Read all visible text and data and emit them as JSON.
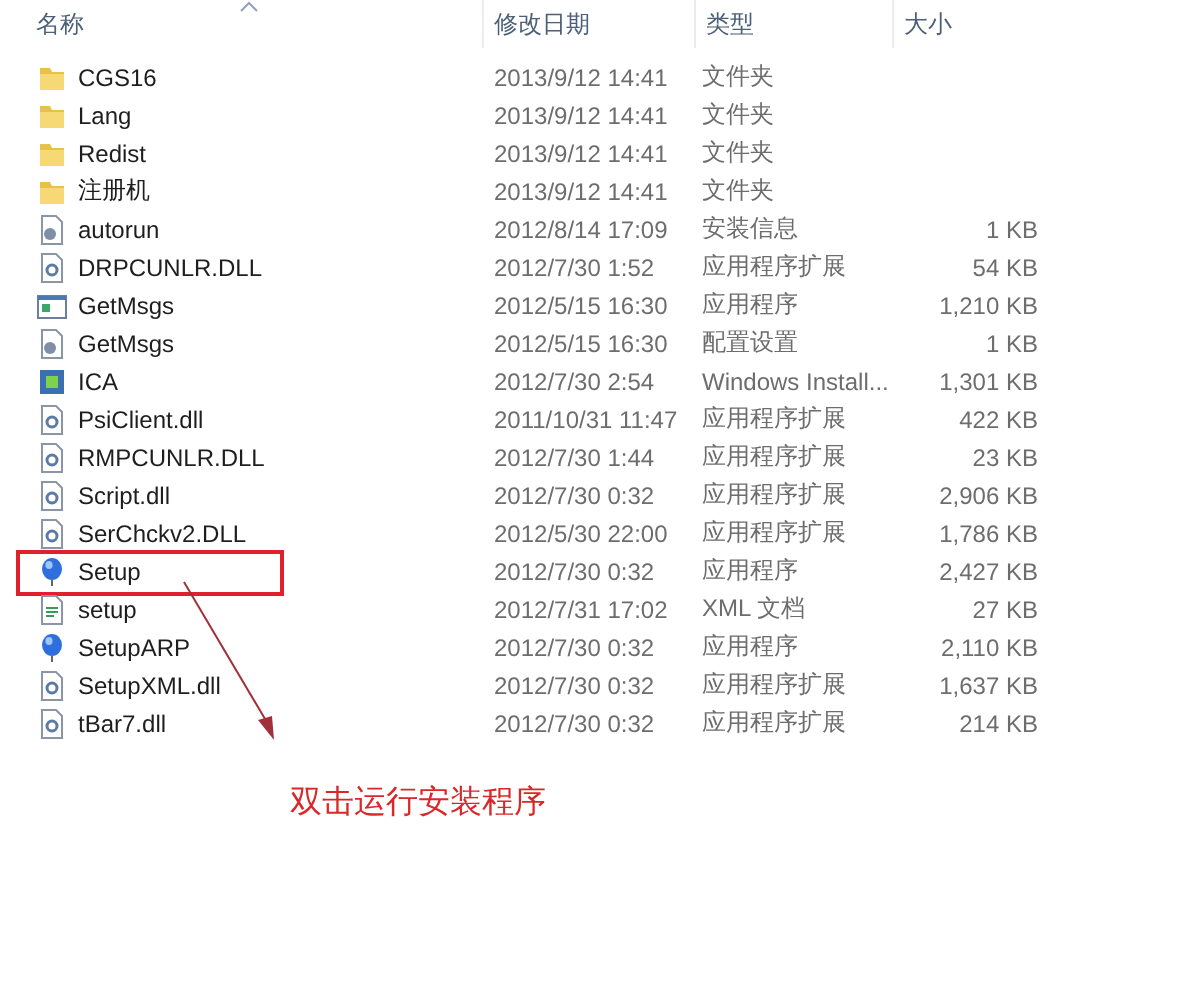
{
  "columns": [
    {
      "label": "名称",
      "sorted": true
    },
    {
      "label": "修改日期",
      "sorted": false
    },
    {
      "label": "类型",
      "sorted": false
    },
    {
      "label": "大小",
      "sorted": false
    }
  ],
  "rows": [
    {
      "kind": "folder",
      "name": "CGS16",
      "date": "2013/9/12 14:41",
      "type": "文件夹",
      "boxed": false
    },
    {
      "kind": "folder",
      "name": "Lang",
      "date": "2013/9/12 14:41",
      "type": "文件夹",
      "boxed": false
    },
    {
      "kind": "folder",
      "name": "Redist",
      "date": "2013/9/12 14:41",
      "type": "文件夹",
      "boxed": false
    },
    {
      "kind": "folder",
      "name": "注册机",
      "date": "2013/9/12 14:41",
      "type": "文件夹",
      "boxed": false
    },
    {
      "kind": "settings",
      "name": "autorun",
      "date": "2012/8/14 17:09",
      "type": "安装信息",
      "size": "1 KB",
      "boxed": false
    },
    {
      "kind": "dll",
      "name": "DRPCUNLR.DLL",
      "date": "2012/7/30 1:52",
      "type": "应用程序扩展",
      "size": "54 KB",
      "boxed": false
    },
    {
      "kind": "window",
      "name": "GetMsgs",
      "date": "2012/5/15 16:30",
      "type": "应用程序",
      "size": "1,210 KB",
      "boxed": false
    },
    {
      "kind": "settings",
      "name": "GetMsgs",
      "date": "2012/5/15 16:30",
      "type": "配置设置",
      "size": "1 KB",
      "boxed": false
    },
    {
      "kind": "installer",
      "name": "ICA",
      "date": "2012/7/30 2:54",
      "type": "Windows Install...",
      "size": "1,301 KB",
      "boxed": false
    },
    {
      "kind": "dll",
      "name": "PsiClient.dll",
      "date": "2011/10/31 11:47",
      "type": "应用程序扩展",
      "size": "422 KB",
      "boxed": false
    },
    {
      "kind": "dll",
      "name": "RMPCUNLR.DLL",
      "date": "2012/7/30 1:44",
      "type": "应用程序扩展",
      "size": "23 KB",
      "boxed": false
    },
    {
      "kind": "dll",
      "name": "Script.dll",
      "date": "2012/7/30 0:32",
      "type": "应用程序扩展",
      "size": "2,906 KB",
      "boxed": false
    },
    {
      "kind": "dll",
      "name": "SerChckv2.DLL",
      "date": "2012/5/30 22:00",
      "type": "应用程序扩展",
      "size": "1,786 KB",
      "boxed": false
    },
    {
      "kind": "balloon",
      "name": "Setup",
      "date": "2012/7/30 0:32",
      "type": "应用程序",
      "size": "2,427 KB",
      "boxed": true
    },
    {
      "kind": "xml",
      "name": "setup",
      "date": "2012/7/31 17:02",
      "type": "XML 文档",
      "size": "27 KB",
      "boxed": false
    },
    {
      "kind": "balloon",
      "name": "SetupARP",
      "date": "2012/7/30 0:32",
      "type": "应用程序",
      "size": "2,110 KB",
      "boxed": false
    },
    {
      "kind": "dll",
      "name": "SetupXML.dll",
      "date": "2012/7/30 0:32",
      "type": "应用程序扩展",
      "size": "1,637 KB",
      "boxed": false
    },
    {
      "kind": "dll",
      "name": "tBar7.dll",
      "date": "2012/7/30 0:32",
      "type": "应用程序扩展",
      "size": "214 KB",
      "boxed": false
    }
  ],
  "annotation": "双击运行安装程序"
}
